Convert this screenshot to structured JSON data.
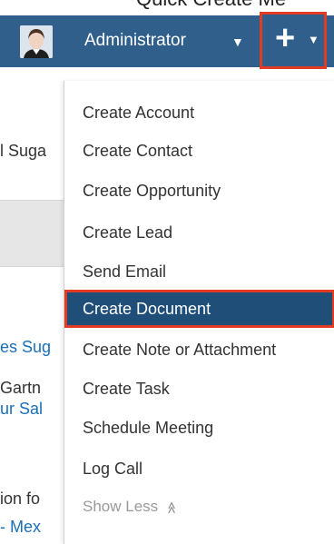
{
  "header": {
    "top_clipped_text": "Quick Create Me",
    "user_name": "Administrator",
    "user_caret_icon": "chevron-down-icon",
    "create_button_icon": "plus-icon",
    "create_caret_icon": "chevron-down-icon",
    "colors": {
      "bar": "#2f5f8a",
      "highlight_border": "#e13b26",
      "selected_bg": "#1f4e79"
    }
  },
  "background": {
    "lines": [
      {
        "text": "l Suga",
        "style": "dark"
      },
      {
        "text": "es Sug",
        "style": "link"
      },
      {
        "text": " Gartn",
        "style": "dark"
      },
      {
        "text": "ur Sal",
        "style": "link"
      },
      {
        "text": "ion fo",
        "style": "dark"
      },
      {
        "text": "- Mex",
        "style": "link"
      }
    ]
  },
  "menu": {
    "items": [
      {
        "label": "Create Account"
      },
      {
        "label": "Create Contact"
      },
      {
        "label": "Create Opportunity"
      },
      {
        "label": "Create Lead"
      },
      {
        "label": "Send Email"
      },
      {
        "label": "Create Document",
        "selected": true
      },
      {
        "label": "Create Note or Attachment"
      },
      {
        "label": "Create Task"
      },
      {
        "label": "Schedule Meeting"
      },
      {
        "label": "Log Call"
      }
    ],
    "show_less": {
      "label": "Show Less",
      "icon": "double-chevron-up-icon"
    }
  }
}
